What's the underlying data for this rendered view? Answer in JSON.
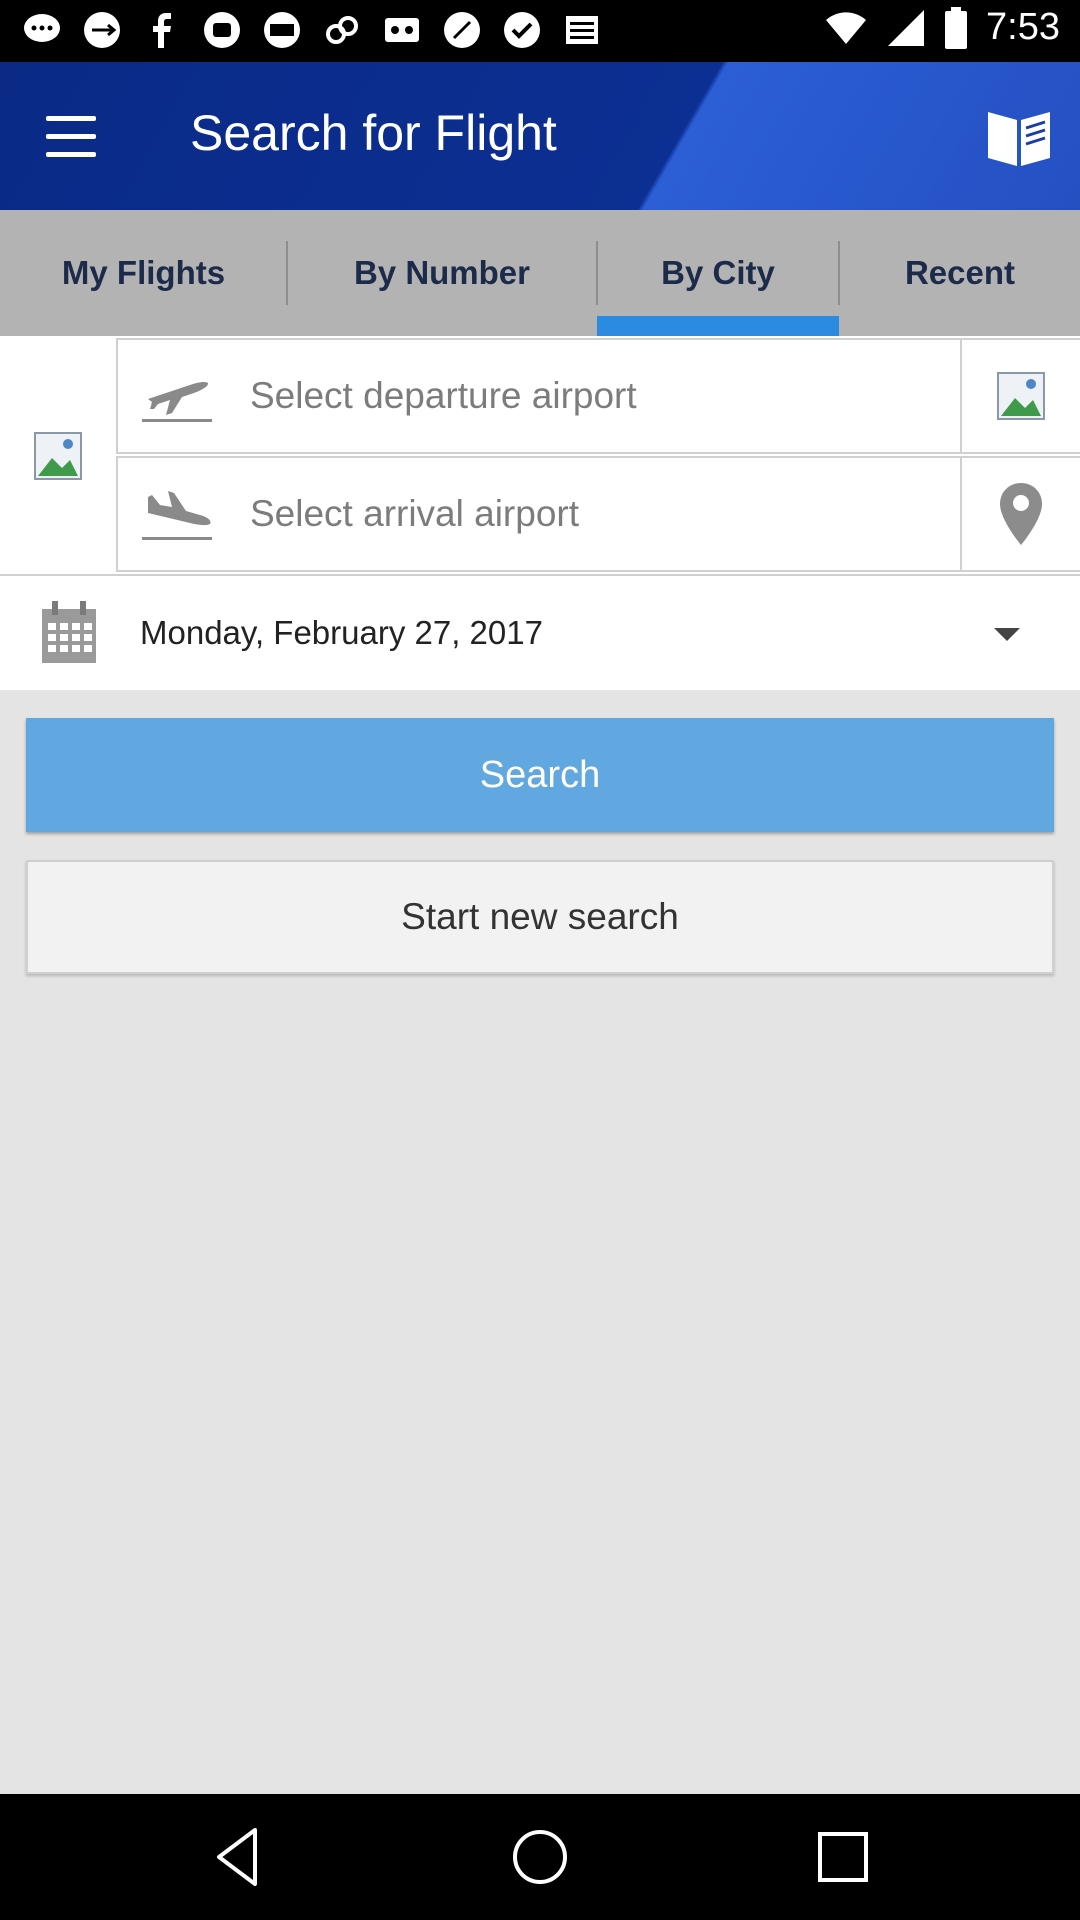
{
  "status_bar": {
    "time": "7:53",
    "icons": [
      "chat-bubble-icon",
      "usb-icon",
      "facebook-icon",
      "phone-icon",
      "usa-today-icon",
      "link-icon",
      "voicemail-icon",
      "fiddle-icon",
      "check-icon",
      "news-icon"
    ],
    "right_icons": [
      "wifi-icon",
      "signal-icon",
      "battery-icon"
    ]
  },
  "app_bar": {
    "title": "Search for Flight",
    "menu_icon": "menu-icon",
    "guide_icon": "book-icon",
    "colors": {
      "primary": "#0c2f93",
      "accent": "#2a8be1"
    }
  },
  "tabs": [
    {
      "label": "My Flights",
      "selected": false
    },
    {
      "label": "By Number",
      "selected": false
    },
    {
      "label": "By City",
      "selected": true
    },
    {
      "label": "Recent",
      "selected": false
    }
  ],
  "form": {
    "departure_placeholder": "Select departure airport",
    "arrival_placeholder": "Select arrival airport",
    "date": "Monday, February 27, 2017"
  },
  "buttons": {
    "search": "Search",
    "new_search": "Start new search"
  },
  "nav_bar": [
    "back-icon",
    "home-icon",
    "recents-icon"
  ]
}
